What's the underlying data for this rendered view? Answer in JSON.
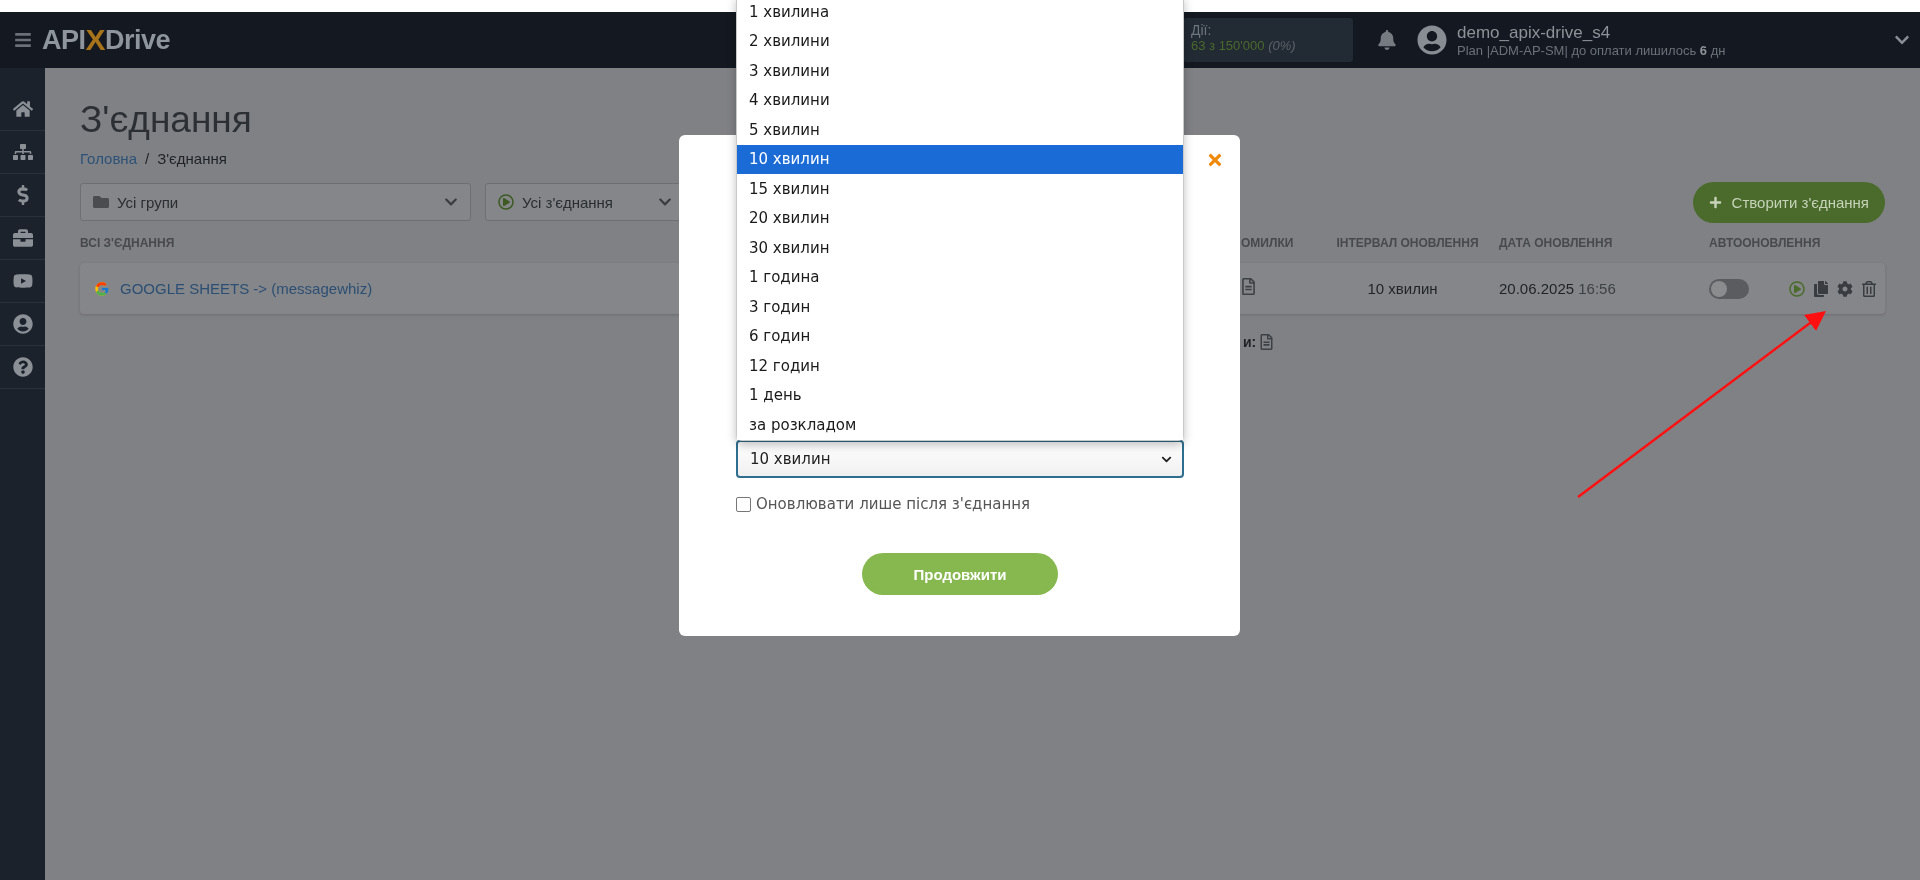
{
  "header": {
    "logo": {
      "before": "API",
      "mark": "X",
      "after": "Drive"
    },
    "actions": {
      "label": "Дії:",
      "value": "63 з 150'000",
      "percent": "(0%)"
    },
    "user": {
      "name": "demo_apix-drive_s4",
      "plan": "Plan |ADM-AP-SM| до оплати лишилось **6** дн"
    }
  },
  "sidebar": {
    "items": [
      {
        "kind": "home"
      },
      {
        "kind": "sitemap"
      },
      {
        "kind": "dollar"
      },
      {
        "kind": "briefcase"
      },
      {
        "kind": "video"
      },
      {
        "kind": "user"
      },
      {
        "kind": "help"
      }
    ]
  },
  "page": {
    "title": "З'єднання",
    "breadcrumbs": {
      "home": "Головна",
      "separator": "/",
      "current": "З'єднання"
    },
    "filters": [
      {
        "kind": "group",
        "value": "Усі групи"
      },
      {
        "kind": "status",
        "value": "Усі з'єднання"
      }
    ],
    "create_button": "Створити з'єднання"
  },
  "table": {
    "section_label": "ВСІ З'ЄДНАННЯ",
    "columns": [
      "ОМИЛКИ",
      "ІНТЕРВАЛ ОНОВЛЕННЯ",
      "ДАТА ОНОВЛЕННЯ",
      "АВТООНОВЛЕННЯ"
    ],
    "rows": [
      {
        "name": "GOOGLE SHEETS -> (messagewhiz)",
        "interval": "10 хвилин",
        "date": "20.06.2025",
        "time": "16:56",
        "auto_update": false
      }
    ],
    "footer": {
      "right": "и:"
    }
  },
  "modal": {
    "options": [
      {
        "label": "1 хвилина",
        "selected": false
      },
      {
        "label": "2 хвилини",
        "selected": false
      },
      {
        "label": "3 хвилини",
        "selected": false
      },
      {
        "label": "4 хвилини",
        "selected": false
      },
      {
        "label": "5 хвилин",
        "selected": false
      },
      {
        "label": "10 хвилин",
        "selected": true
      },
      {
        "label": "15 хвилин",
        "selected": false
      },
      {
        "label": "20 хвилин",
        "selected": false
      },
      {
        "label": "30 хвилин",
        "selected": false
      },
      {
        "label": "1 година",
        "selected": false
      },
      {
        "label": "3 годин",
        "selected": false
      },
      {
        "label": "6 годин",
        "selected": false
      },
      {
        "label": "12 годин",
        "selected": false
      },
      {
        "label": "1 день",
        "selected": false
      },
      {
        "label": "за розкладом",
        "selected": false
      }
    ],
    "select_value": "10 хвилин",
    "checkbox": {
      "label": "Оновлювати лише після з'єднання",
      "checked": false
    },
    "button": "Продовжити"
  }
}
